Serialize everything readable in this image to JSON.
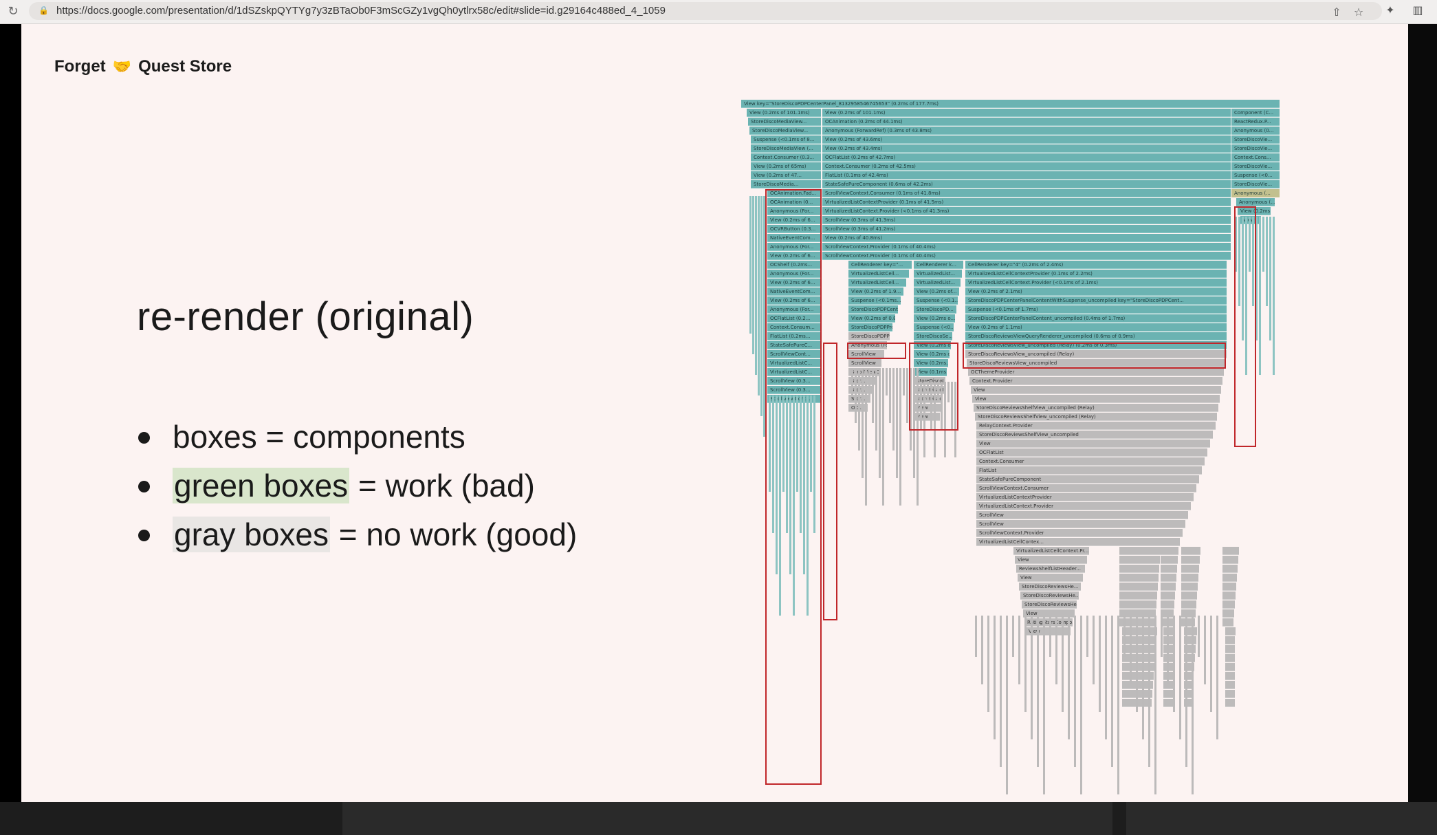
{
  "browser": {
    "url": "https://docs.google.com/presentation/d/1dSZskpQYTYg7y3zBTaOb0F3mScGZy1vgQh0ytlrx58c/edit#slide=id.g29164c488ed_4_1059",
    "reload_glyph": "↻",
    "lock_glyph": "🔒",
    "share_glyph": "⇧",
    "star_glyph": "☆",
    "extensions_glyph": "✦",
    "sidebar_glyph": "▥"
  },
  "slide": {
    "header_left": "Forget",
    "header_icon": "🤝",
    "header_right": "Quest Store",
    "title": "re-render (original)",
    "bullets": [
      {
        "pre": "",
        "hl": "",
        "text": "boxes = components"
      },
      {
        "pre": "",
        "hl": "green boxes",
        "text": " = work (bad)"
      },
      {
        "pre": "",
        "hl": "gray boxes",
        "text": " = no work (good)"
      }
    ]
  },
  "flamegraph": {
    "legend": {
      "green": "work (bad)",
      "gray": "no work (good)"
    },
    "colors": {
      "green": "#6bb3b2",
      "gray": "#bdbbbb",
      "highlight": "#c0262a"
    },
    "frames": [
      "View key=\"StoreDiscoPDPCenterPanel_8132958546745653\" (0.2ms of 177.7ms)",
      "View (0.2ms of 101.1ms)",
      "StoreDiscoMediaView...",
      "OCAnimation (0.2ms of 44.1ms)",
      "Anonymous (ForwardRef) (0.3ms of 43.8ms)",
      "View (0.2ms of 43.6ms)",
      "View (0.2ms of 43.4ms)",
      "OCFlatList (0.2ms of 42.7ms)",
      "Context.Consumer (0.2ms of 42.5ms)",
      "FlatList (0.1ms of 42.4ms)",
      "StateSafePureComponent (0.6ms of 42.2ms)",
      "ScrollViewContext.Consumer (0.1ms of 41.8ms)",
      "VirtualizedListContextProvider (0.1ms of 41.5ms)",
      "VirtualizedListContext.Provider (<0.1ms of 41.3ms)",
      "ScrollView (0.3ms of 41.3ms)",
      "ScrollView (0.3ms of 41.2ms)",
      "View (0.2ms of 40.8ms)",
      "ScrollViewContext.Provider (0.1ms of 40.4ms)",
      "CellRenderer key=\"4\" (0.2ms of 2.4ms)",
      "VirtualizedListCellContextProvider (0.1ms of 2.2ms)",
      "VirtualizedListCellContext.Provider (<0.1ms of 2.1ms)",
      "View (0.2ms of 2.1ms)",
      "StoreDiscoPDPCenterPanelContentWithSuspense_uncompiled key=\"StoreDiscoPDPCent...",
      "Suspense (<0.1ms of 1.7ms)",
      "StoreDiscoPDPCenterPanelContent_uncompiled (0.4ms of 1.7ms)",
      "View (0.2ms of 1.1ms)",
      "StoreDiscoReviewsViewQueryRenderer_uncompiled (0.6ms of 0.9ms)",
      "StoreDiscoReviewsView_uncompiled (Relay) (0.2ms of 0.3ms)",
      "StoreDiscoReviewsView_uncompiled (Relay)",
      "StoreDiscoReviewsView_uncompiled",
      "OCThemeProvider",
      "Context.Provider",
      "View",
      "View",
      "StoreDiscoReviewsShelfView_uncompiled (Relay)",
      "StoreDiscoReviewsShelfView_uncompiled (Relay)",
      "RelayContext.Provider",
      "StoreDiscoReviewsShelfView_uncompiled",
      "View",
      "OCFlatList",
      "Context.Consumer",
      "FlatList",
      "StateSafePureComponent",
      "ScrollViewContext.Consumer",
      "VirtualizedListContextProvider",
      "VirtualizedListContext.Provider",
      "ScrollView",
      "ScrollView",
      "ScrollViewContext.Provider",
      "VirtualizedListCellContex...",
      "VirtualizedListCellContext.Pr...",
      "View",
      "ReviewsShelfListHeader...",
      "View",
      "StoreDiscoReviewsHe...",
      "StoreDiscoReviewsHe...",
      "StoreDiscoReviewsHe...",
      "View",
      "RatingStarsCompo...",
      "View"
    ],
    "left_frames": [
      "View (0.2ms of 101.1ms)",
      "StoreDiscoMediaView...",
      "StoreDiscoMediaView...",
      "Suspense (<0.1ms of 8...",
      "StoreDiscoMediaView (...",
      "Context.Consumer (0.3...",
      "View (0.2ms of 65ms)",
      "View (0.2ms of 47...",
      "StoreDiscoMedia...",
      "OCAnimation.Fad...",
      "OCAnimation (0...",
      "Anonymous (For...",
      "View (0.2ms of 6...",
      "OCVRButton (0.3...",
      "NativeEventCom...",
      "Anonymous (For...",
      "View (0.2ms of 6...",
      "OCShelf (0.2ms...",
      "Anonymous (For...",
      "View (0.2ms of 6...",
      "NativeEventCom...",
      "View (0.2ms of 6...",
      "Anonymous (For...",
      "OCFlatList (0.2...",
      "Context.Consum...",
      "FlatList (0.2ms...",
      "StateSafePureC...",
      "ScrollViewCont...",
      "VirtualizedListC...",
      "VirtualizedListC...",
      "ScrollView (0.3...",
      "ScrollView (0.3...",
      "ScrollViewCont..."
    ],
    "right_frames": [
      "Component (C...",
      "ReactRedux.P...",
      "Anonymous (0...",
      "StoreDiscoVie...",
      "StoreDiscoVie...",
      "Context.Cons...",
      "StoreDiscoVie...",
      "Suspense (<0...",
      "StoreDiscoVie...",
      "Anonymous (...",
      "View (0.2ms ...",
      "View"
    ],
    "mid_frames": [
      "CellRenderer key=\"...",
      "VirtualizedListCell...",
      "VirtualizedListCell...",
      "View (0.2ms of 1.9...",
      "Suspense (<0.1ms...",
      "StoreDiscoPDPCent...",
      "View (0.2ms of 0.8...",
      "StoreDiscoPDPPro...",
      "StoreDiscoPDPPro...",
      "Anonymous (For...",
      "ScrollView",
      "ScrollView",
      "ScrollViewConte...",
      "Stor...",
      "Stor...",
      "Stor...",
      "OC..."
    ],
    "mid2_frames": [
      "CellRenderer k...",
      "VirtualizedList...",
      "VirtualizedList...",
      "View (0.2ms of...",
      "Suspense (<0.1...",
      "StoreDiscoPD...",
      "View (0.2ms o...",
      "Suspense (<0...",
      "StoreDiscoSe...",
      "View (0.2ms o...",
      "View (0.2ms o...",
      "View (0.2ms...",
      "View (0.1ms)",
      "StoreDiscoI...",
      "StoreDiscoI...",
      "StoreDisco...",
      "View",
      "View"
    ]
  }
}
